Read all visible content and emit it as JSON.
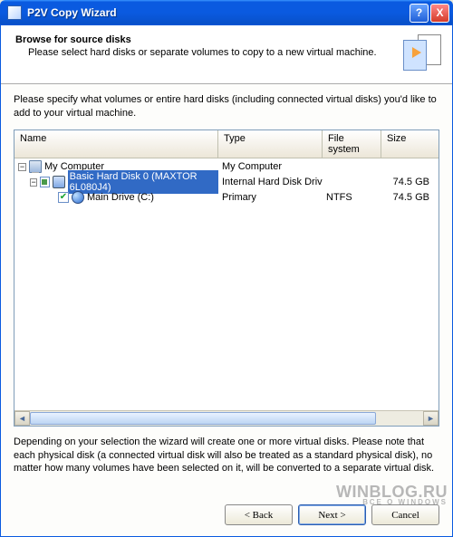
{
  "window": {
    "title": "P2V Copy Wizard",
    "help_glyph": "?",
    "close_glyph": "X"
  },
  "header": {
    "title": "Browse for source disks",
    "subtitle": "Please select hard disks or separate volumes to copy to a new virtual machine."
  },
  "instruction": "Please specify what volumes or entire hard disks (including connected virtual disks) you'd like to add to your virtual machine.",
  "columns": {
    "name": "Name",
    "type": "Type",
    "fs": "File system",
    "size": "Size"
  },
  "tree": {
    "root": {
      "toggle": "−",
      "label": "My Computer",
      "type": "My Computer",
      "fs": "",
      "size": "",
      "icon": "computer"
    },
    "disk0": {
      "toggle": "−",
      "check_state": "partial",
      "label": "Basic Hard Disk 0 (MAXTOR 6L080J4)",
      "type": "Internal Hard Disk Drive",
      "fs": "",
      "size": "74.5 GB",
      "icon": "disk",
      "selected": true
    },
    "vol0": {
      "check_state": "checked",
      "label": "Main Drive (C:)",
      "type": "Primary",
      "fs": "NTFS",
      "size": "74.5 GB",
      "icon": "globe"
    }
  },
  "scroll": {
    "left_glyph": "◄",
    "right_glyph": "►"
  },
  "footnote": "Depending on your selection the wizard will create one or more virtual disks. Please note that each physical disk (a connected virtual disk will also be treated as a standard physical disk), no matter how many volumes have been selected on it, will be converted to a separate virtual disk.",
  "buttons": {
    "back": "< Back",
    "next": "Next >",
    "cancel": "Cancel"
  },
  "watermark": {
    "line1": "WINBLOG.RU",
    "line2": "ВСЕ О WINDOWS"
  }
}
